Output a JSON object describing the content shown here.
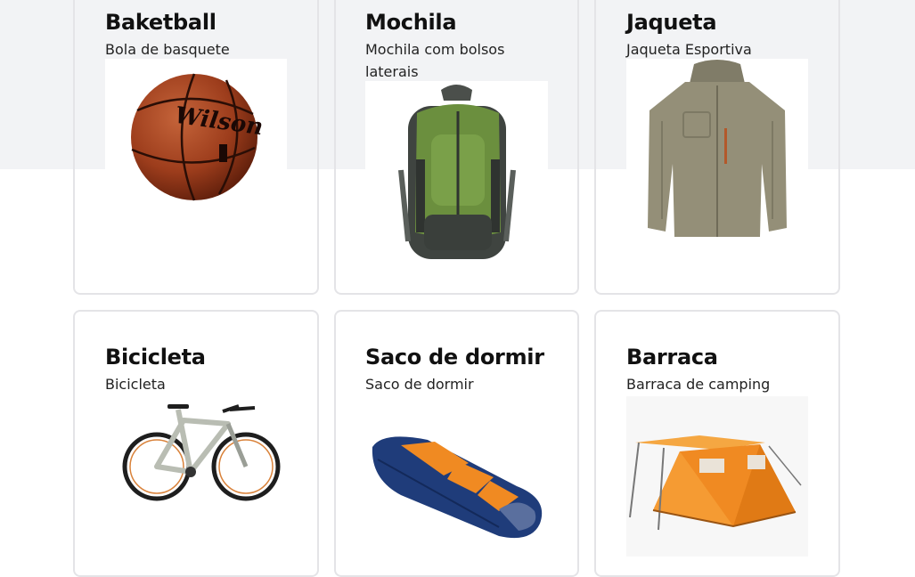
{
  "products": [
    {
      "title": "Baketball",
      "description": "Bola de basquete",
      "image": "basketball-image"
    },
    {
      "title": "Mochila",
      "description": "Mochila com bolsos laterais",
      "image": "backpack-image"
    },
    {
      "title": "Jaqueta",
      "description": "Jaqueta Esportiva",
      "image": "jacket-image"
    },
    {
      "title": "Bicicleta",
      "description": "Bicicleta",
      "image": "bicycle-image"
    },
    {
      "title": "Saco de dormir",
      "description": "Saco de dormir",
      "image": "sleeping-bag-image"
    },
    {
      "title": "Barraca",
      "description": "Barraca de camping",
      "image": "tent-image"
    }
  ],
  "brand_text": {
    "ball": "Wilson"
  },
  "colors": {
    "page_band": "#f2f3f5",
    "card_border": "#e4e4e7",
    "text": "#111111"
  }
}
